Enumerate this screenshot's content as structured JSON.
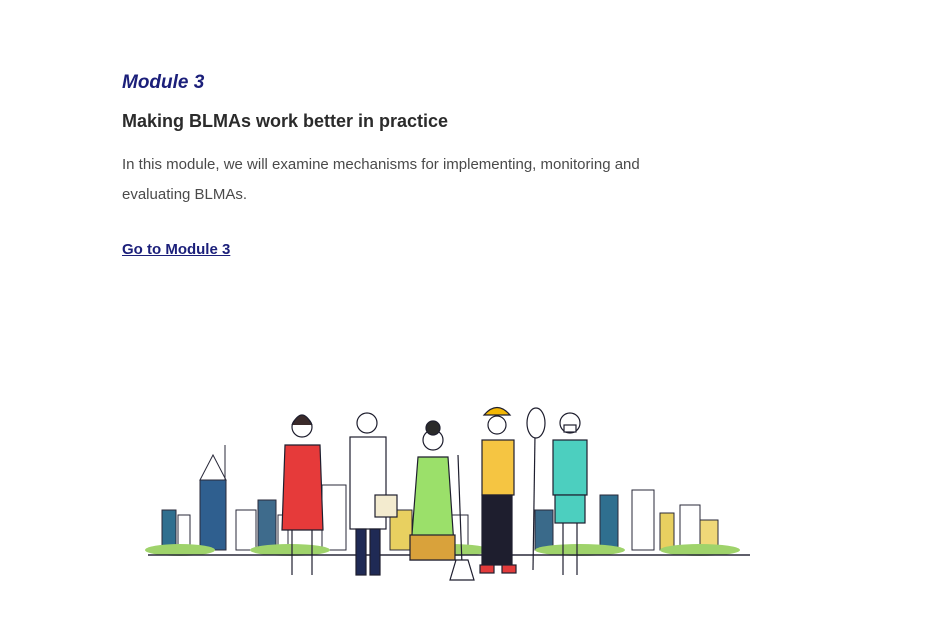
{
  "module": {
    "label": "Module 3",
    "title": "Making BLMAs work better in practice",
    "description": "In this module, we will examine mechanisms for implementing, monitoring and evaluating BLMAs.",
    "link_label": "Go to Module 3"
  },
  "illustration": {
    "subject": "workers-in-front-of-city-skyline",
    "figures": [
      "woman-red-dress",
      "doctor",
      "woman-green-dress-with-broom",
      "construction-worker-with-shovel",
      "health-worker-with-mask"
    ]
  },
  "colors": {
    "accent": "#1b1f7a",
    "title": "#2b2b2b",
    "text": "#4a4a4a"
  }
}
